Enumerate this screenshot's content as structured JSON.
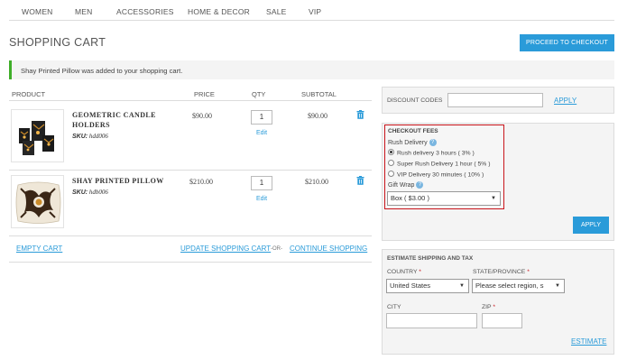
{
  "nav": {
    "items": [
      "WOMEN",
      "MEN",
      "ACCESSORIES",
      "HOME & DECOR",
      "SALE",
      "VIP"
    ]
  },
  "page": {
    "title": "SHOPPING CART",
    "checkout_label": "PROCEED TO CHECKOUT",
    "notice": "Shay Printed Pillow was added to your shopping cart."
  },
  "table": {
    "headers": {
      "product": "PRODUCT",
      "price": "PRICE",
      "qty": "QTY",
      "subtotal": "SUBTOTAL"
    },
    "rows": [
      {
        "name_line1": "GEOMETRIC CANDLE",
        "name_line2": "HOLDERS",
        "sku_label": "SKU:",
        "sku": "hdd006",
        "price": "$90.00",
        "qty": "1",
        "edit": "Edit",
        "subtotal": "$90.00"
      },
      {
        "name_line1": "SHAY PRINTED PILLOW",
        "sku_label": "SKU:",
        "sku": "hdb006",
        "price": "$210.00",
        "qty": "1",
        "edit": "Edit",
        "subtotal": "$210.00"
      }
    ]
  },
  "actions": {
    "empty_cart": "EMPTY CART",
    "update_cart": "UPDATE SHOPPING CART",
    "or": "-OR-",
    "continue": "CONTINUE SHOPPING"
  },
  "discount": {
    "label": "DISCOUNT CODES",
    "value": "",
    "apply": "APPLY"
  },
  "fees": {
    "title": "CHECKOUT FEES",
    "rush_label": "Rush Delivery",
    "options": [
      {
        "label": "Rush delivery 3 hours ( 3% )",
        "selected": true
      },
      {
        "label": "Super Rush Delivery 1 hour ( 5% )",
        "selected": false
      },
      {
        "label": "VIP Delivery 30 minutes ( 10% )",
        "selected": false
      }
    ],
    "gift_label": "Gift Wrap",
    "gift_value": "Box ( $3.00 )",
    "apply": "APPLY"
  },
  "shipping": {
    "title": "ESTIMATE SHIPPING AND TAX",
    "country_label": "COUNTRY",
    "country_value": "United States",
    "state_label": "STATE/PROVINCE",
    "state_value": "Please select region, s",
    "city_label": "CITY",
    "city_value": "",
    "zip_label": "ZIP",
    "zip_value": "",
    "required_mark": "*",
    "estimate": "ESTIMATE"
  },
  "colors": {
    "accent": "#2a9bd9",
    "success": "#3fae29",
    "highlight_border": "#c8141b"
  }
}
